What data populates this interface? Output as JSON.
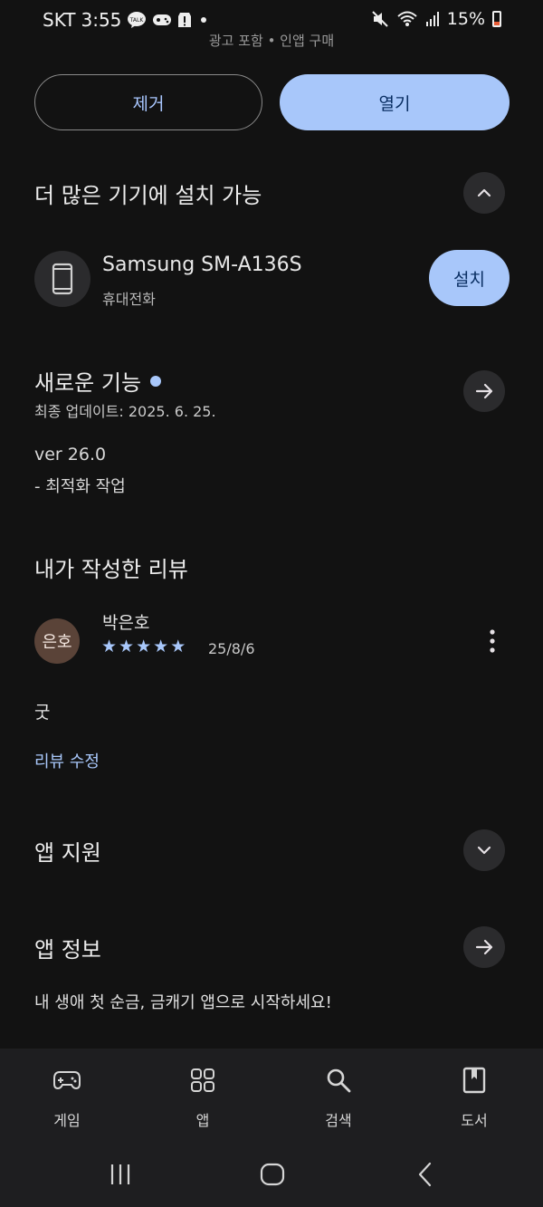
{
  "status_bar": {
    "carrier": "SKT",
    "time": "3:55",
    "battery": "15%"
  },
  "header": {
    "peek_text": "광고 포함 • 인앱 구매"
  },
  "actions": {
    "remove_label": "제거",
    "open_label": "열기"
  },
  "more_devices": {
    "title": "더 많은 기기에 설치 가능",
    "device_name": "Samsung SM-A136S",
    "device_type": "휴대전화",
    "install_label": "설치"
  },
  "whats_new": {
    "title": "새로운 기능",
    "updated": "최종 업데이트: 2025. 6. 25.",
    "version": "ver 26.0",
    "notes": "- 최적화 작업"
  },
  "my_review": {
    "title": "내가 작성한 리뷰",
    "avatar_text": "은호",
    "reviewer": "박은호",
    "rating": 5,
    "stars": [
      "★",
      "★",
      "★",
      "★",
      "★"
    ],
    "date": "25/8/6",
    "text": "굿",
    "edit_label": "리뷰 수정"
  },
  "app_support": {
    "title": "앱 지원"
  },
  "app_info": {
    "title": "앱 정보",
    "description": "내 생애 첫 순금, 금캐기 앱으로 시작하세요!"
  },
  "bottom_nav": {
    "items": [
      {
        "label": "게임",
        "icon": "gamepad-icon"
      },
      {
        "label": "앱",
        "icon": "apps-grid-icon"
      },
      {
        "label": "검색",
        "icon": "search-icon"
      },
      {
        "label": "도서",
        "icon": "book-icon"
      }
    ]
  },
  "colors": {
    "background": "#121212",
    "accent": "#a8c7fa",
    "surface": "#2b2b2d"
  }
}
